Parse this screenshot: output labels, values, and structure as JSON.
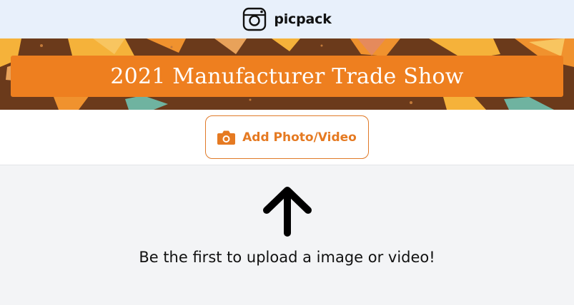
{
  "header": {
    "brand": "picpack",
    "logo_icon": "instagram-camera-icon"
  },
  "banner": {
    "title": "2021 Manufacturer Trade Show",
    "colors": {
      "background": "#6b3a1b",
      "title_box": "#ee7f1f",
      "gem_yellow": "#f5b23a",
      "gem_orange": "#f0922e",
      "gem_teal": "#6fb3a0"
    }
  },
  "actions": {
    "add_label": "Add Photo/Video",
    "add_icon": "camera-icon",
    "accent": "#e57a22"
  },
  "empty_state": {
    "icon": "arrow-up-icon",
    "message": "Be the first to upload a image or video!"
  }
}
